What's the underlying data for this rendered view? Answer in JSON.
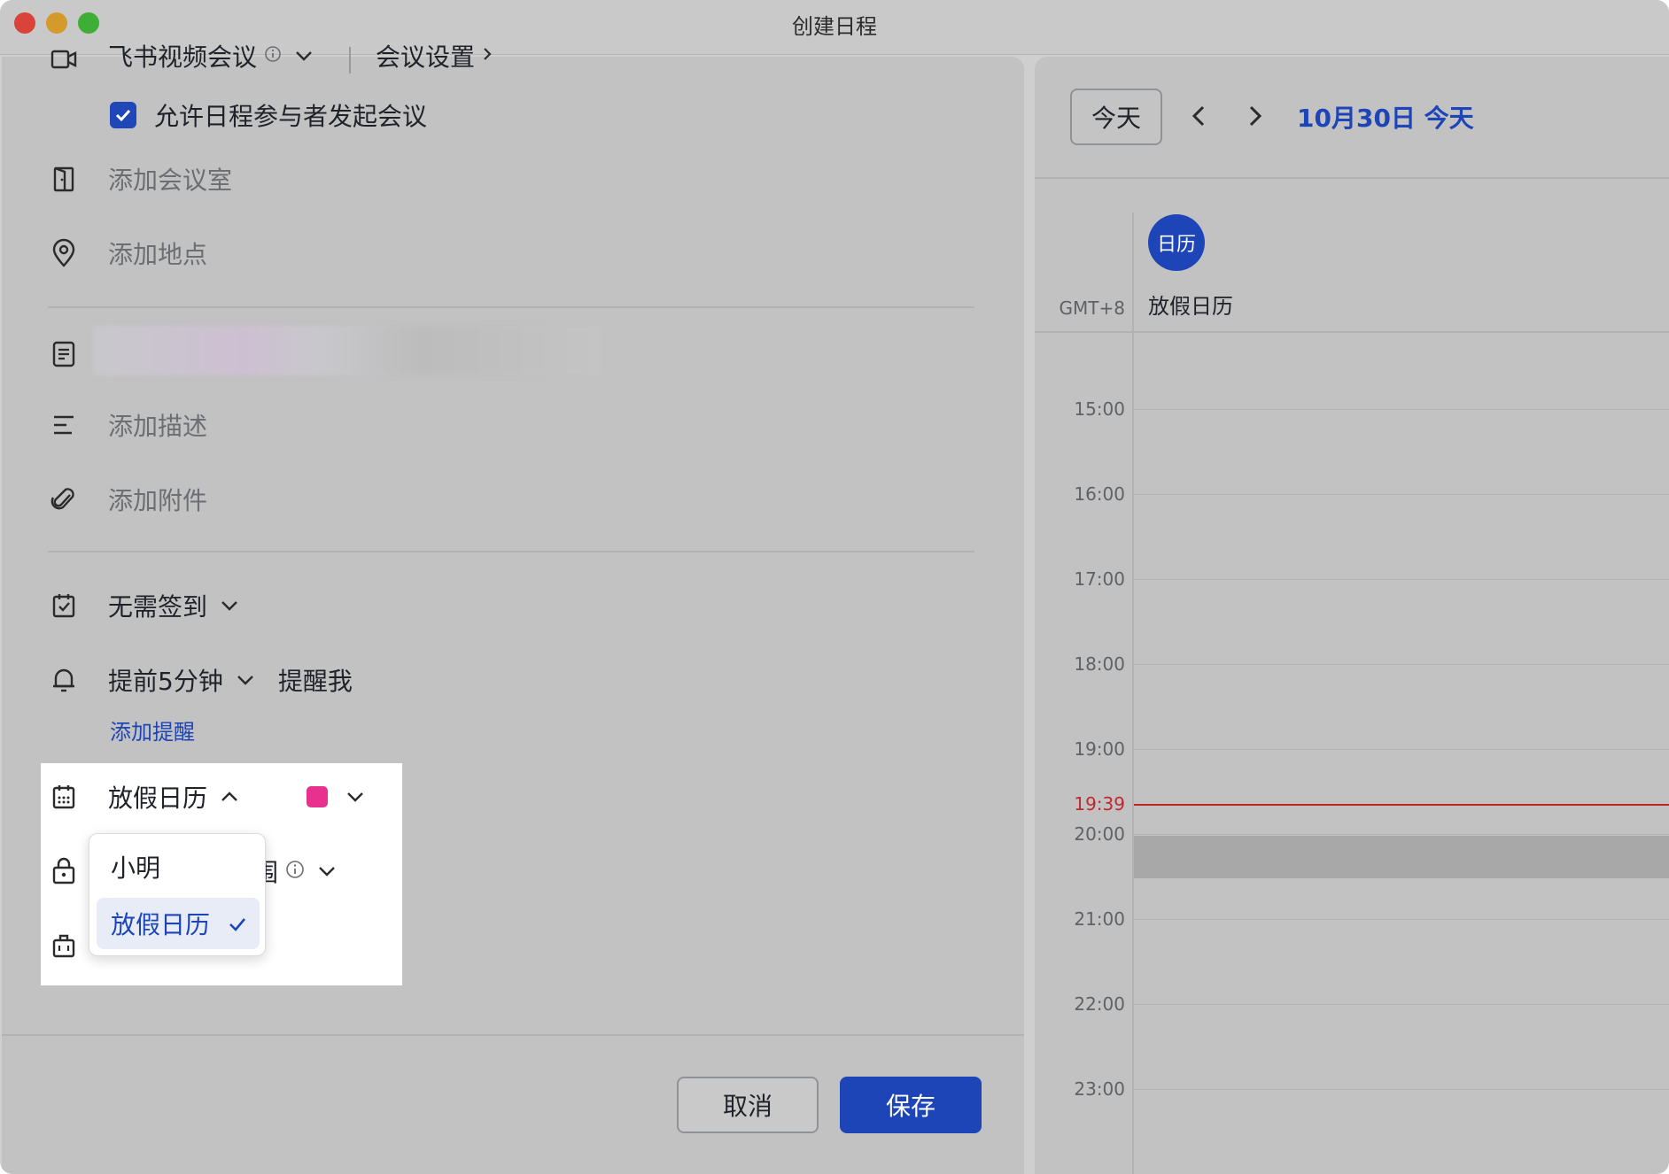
{
  "window": {
    "title": "创建日程"
  },
  "meeting": {
    "video_label": "飞书视频会议",
    "settings_label": "会议设置",
    "allow_attendees_label": "允许日程参与者发起会议",
    "allow_attendees_checked": true
  },
  "fields": {
    "add_room": "添加会议室",
    "add_location": "添加地点",
    "add_description": "添加描述",
    "add_attachment": "添加附件"
  },
  "checkin": {
    "value": "无需签到"
  },
  "reminder": {
    "value": "提前5分钟",
    "suffix": "提醒我",
    "add_link": "添加提醒"
  },
  "calendar_select": {
    "value": "放假日历",
    "color": "#e8318f",
    "options": [
      {
        "label": "小明",
        "selected": false
      },
      {
        "label": "放假日历",
        "selected": true
      }
    ]
  },
  "visibility": {
    "label_fragment": "围"
  },
  "footer": {
    "cancel": "取消",
    "save": "保存"
  },
  "calendar_view": {
    "today_button": "今天",
    "date_label": "10月30日 今天",
    "timezone": "GMT+8",
    "calendar_avatar": "日历",
    "calendar_name": "放假日历",
    "hours": [
      "15:00",
      "16:00",
      "17:00",
      "18:00",
      "19:00",
      "20:00",
      "21:00",
      "22:00",
      "23:00"
    ],
    "current_time": "19:39",
    "accent_color": "#1e45b8",
    "now_color": "#c1272d"
  }
}
